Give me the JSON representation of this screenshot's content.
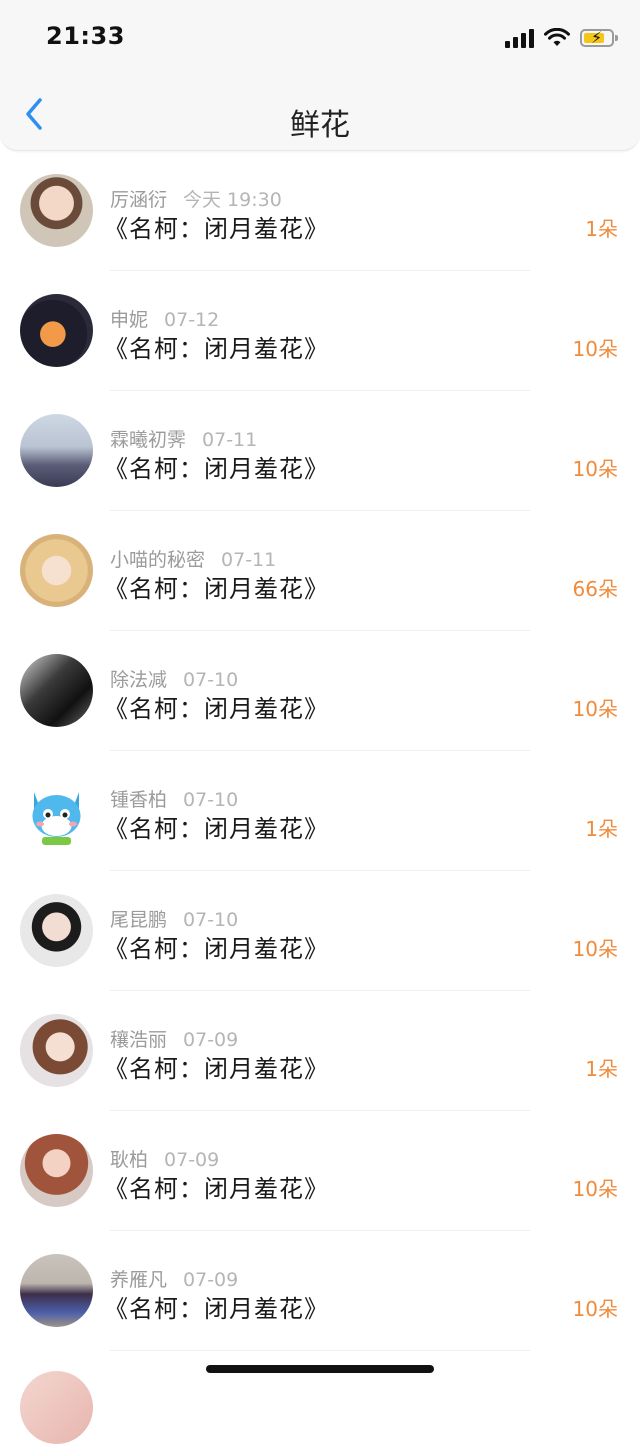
{
  "status_bar": {
    "time": "21:33"
  },
  "header": {
    "title": "鲜花"
  },
  "items": [
    {
      "name": "厉涵衍",
      "date": "今天 19:30",
      "movie": "《名柯：闭月羞花》",
      "count": "1朵"
    },
    {
      "name": "申妮",
      "date": "07-12",
      "movie": "《名柯：闭月羞花》",
      "count": "10朵"
    },
    {
      "name": "霖曦初霁",
      "date": "07-11",
      "movie": "《名柯：闭月羞花》",
      "count": "10朵"
    },
    {
      "name": "小喵的秘密",
      "date": "07-11",
      "movie": "《名柯：闭月羞花》",
      "count": "66朵"
    },
    {
      "name": "除法减",
      "date": "07-10",
      "movie": "《名柯：闭月羞花》",
      "count": "10朵"
    },
    {
      "name": "锺香柏",
      "date": "07-10",
      "movie": "《名柯：闭月羞花》",
      "count": "1朵"
    },
    {
      "name": "尾昆鹏",
      "date": "07-10",
      "movie": "《名柯：闭月羞花》",
      "count": "10朵"
    },
    {
      "name": "穰浩丽",
      "date": "07-09",
      "movie": "《名柯：闭月羞花》",
      "count": "1朵"
    },
    {
      "name": "耿柏",
      "date": "07-09",
      "movie": "《名柯：闭月羞花》",
      "count": "10朵"
    },
    {
      "name": "养雁凡",
      "date": "07-09",
      "movie": "《名柯：闭月羞花》",
      "count": "10朵"
    }
  ],
  "colors": {
    "accent": "#f08b3c",
    "back_icon": "#2f8ff0"
  }
}
